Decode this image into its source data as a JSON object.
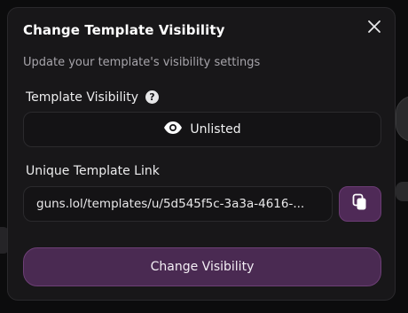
{
  "modal": {
    "title": "Change Template Visibility",
    "subtitle": "Update your template's visibility settings",
    "close_icon": "close-icon"
  },
  "visibility": {
    "label": "Template Visibility",
    "help_icon": "help-icon",
    "help_glyph": "?",
    "selected_icon": "eye-icon",
    "selected_value": "Unlisted"
  },
  "link": {
    "label": "Unique Template Link",
    "value": "guns.lol/templates/u/5d545f5c-3a3a-4616-...",
    "copy_icon": "copy-icon"
  },
  "actions": {
    "primary_label": "Change Visibility"
  },
  "colors": {
    "modal_bg": "#181719",
    "accent": "#4a2a52",
    "accent_border": "#6d3f76"
  }
}
